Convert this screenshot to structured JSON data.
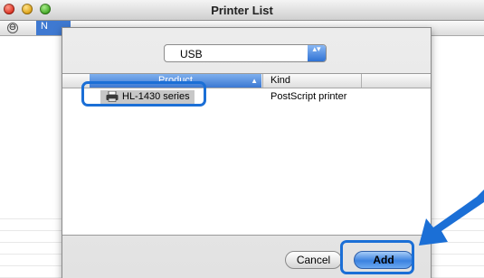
{
  "window": {
    "title": "Printer List"
  },
  "background_window": {
    "header_circle": "⊖",
    "header_col_fragment": "N"
  },
  "sheet": {
    "connection_select": {
      "value": "USB",
      "arrows": "▴▾"
    },
    "table": {
      "columns": [
        {
          "label": "Product",
          "sorted": true,
          "sort_glyph": "▲"
        },
        {
          "label": "Kind",
          "sorted": false
        }
      ],
      "rows": [
        {
          "product": "HL-1430 series",
          "kind": "PostScript printer",
          "selected": true
        }
      ]
    },
    "buttons": {
      "cancel_label": "Cancel",
      "add_label": "Add"
    }
  },
  "annotations": {
    "highlight_color": "#1b6fd6",
    "pointer_color": "#1b6fd6"
  },
  "colors": {
    "selection_blue": "#3c78d2",
    "default_button_blue": "#3b82e0"
  }
}
